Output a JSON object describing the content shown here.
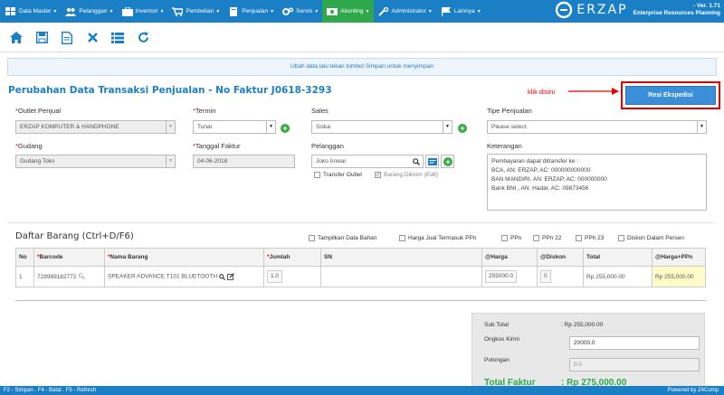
{
  "nav": {
    "items": [
      {
        "label": "Data Master"
      },
      {
        "label": "Pelanggan"
      },
      {
        "label": "Inventori"
      },
      {
        "label": "Pembelian"
      },
      {
        "label": "Penjualan"
      },
      {
        "label": "Servis"
      },
      {
        "label": "Akunting"
      },
      {
        "label": "Administrator"
      },
      {
        "label": "Lainnya"
      }
    ],
    "brand": "ERZAP",
    "version": "- Ver. 1.71",
    "tagline": "Enterprise Resources Planning",
    "active_color": "#2ea84b",
    "bar_color": "#1a7fc5"
  },
  "toolbar": {
    "icons": [
      "home-icon",
      "save-icon",
      "document-icon",
      "close-icon",
      "list-icon",
      "refresh-icon"
    ]
  },
  "notice": "Ubah data lalu tekan tombol Simpan untuk menyimpan",
  "page_title": "Perubahan Data Transaksi Penjualan - No Faktur J0618-3293",
  "hint": "klik disini",
  "resi_button": "Resi Ekspedisi",
  "form": {
    "outlet_label": "Outlet Penjual",
    "outlet_value": "ERZAP KOMPUTER & HANDPHONE",
    "termin_label": "Termin",
    "termin_value": "Tunai",
    "sales_label": "Sales",
    "sales_value": "Siska",
    "tipe_label": "Tipe Penjualan",
    "tipe_placeholder": "Please select",
    "gudang_label": "Gudang",
    "gudang_value": "Gudang Toko",
    "tanggal_label": "Tanggal Faktur",
    "tanggal_value": "04-06-2018",
    "pelanggan_label": "Pelanggan",
    "pelanggan_value": "Joko Anwar",
    "transfer_outlet": "Transfer Outlet",
    "barang_dikirim": "Barang Dikirim",
    "barang_dikirim_note": "(Edit)",
    "keterangan_label": "Keterangan",
    "keterangan_lines": [
      "Pembayaran dapat ditransfer ke :",
      "BCA, AN: ERZAP, AC: 000000000000",
      "BAN MANDIRI, AN: ERZAP, AC: 000000000",
      "Bank BNI , AN: Hadar, AC: 09873456"
    ]
  },
  "daftar": {
    "title": "Daftar Barang (Ctrl+D/F6)",
    "options": [
      "Tampilkan Data Bahan",
      "Harga Jual Termasuk PPn",
      "PPn",
      "PPn 22",
      "PPh 23",
      "Diskon Dalam Persen"
    ],
    "headers": {
      "no": "No",
      "barcode": "Barcode",
      "nama": "Nama Barang",
      "jumlah": "Jumlah",
      "sn": "SN",
      "harga": "@Harga",
      "diskon": "@Diskon",
      "total": "Total",
      "harga_ppn": "@Harga+PPn"
    },
    "row": {
      "no": "1",
      "barcode": "728989182772",
      "nama": "SPEAKER ADVANCE T101 BLUETOOTH",
      "jumlah": "1.0",
      "sn": "",
      "harga": "255000.0",
      "diskon": "0",
      "total": "Rp 255,000.00",
      "harga_ppn": "Rp 255,000.00"
    }
  },
  "summary": {
    "subtotal_label": "Sub Total",
    "subtotal_value": ": Rp 255,000.00",
    "ongkos_label": "Ongkos Kirim",
    "ongkos_value": "20000.0",
    "potongan_label": "Potongan",
    "potongan_value": "0.0",
    "total_label": "Total Faktur",
    "total_value": ": Rp 275,000.00"
  },
  "footer": {
    "shortcuts": "F2 - Simpan . F4 - Batal . F5 - Refresh",
    "powered": "Powered by Z4Comp"
  }
}
